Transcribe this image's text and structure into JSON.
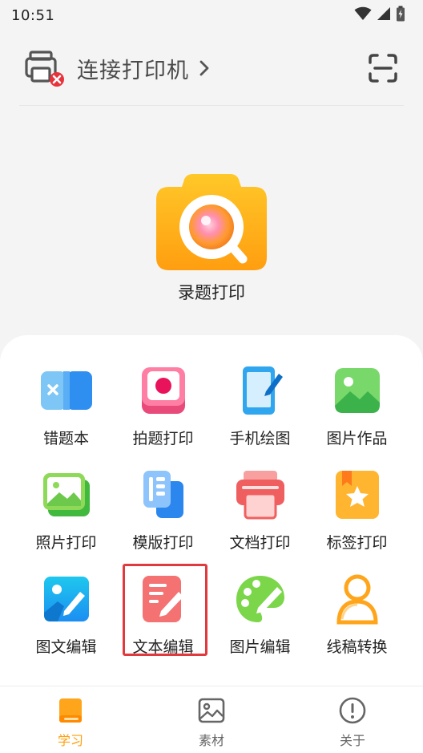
{
  "status_bar": {
    "time": "10:51",
    "icons": [
      "wifi-icon",
      "signal-icon",
      "battery-charging-icon"
    ]
  },
  "header": {
    "printer_label": "连接打印机",
    "icons": [
      "printer-disconnected-icon",
      "chevron-right-icon",
      "scan-icon"
    ]
  },
  "hero": {
    "label": "录题打印",
    "icon": "camera-search-icon",
    "accent": "#ffb31a"
  },
  "grid": {
    "items": [
      {
        "label": "错题本",
        "icon": "wrong-book-icon"
      },
      {
        "label": "拍题打印",
        "icon": "photo-question-print-icon"
      },
      {
        "label": "手机绘图",
        "icon": "phone-drawing-icon"
      },
      {
        "label": "图片作品",
        "icon": "picture-works-icon"
      },
      {
        "label": "照片打印",
        "icon": "photo-print-icon"
      },
      {
        "label": "模版打印",
        "icon": "template-print-icon"
      },
      {
        "label": "文档打印",
        "icon": "document-print-icon"
      },
      {
        "label": "标签打印",
        "icon": "label-print-icon"
      },
      {
        "label": "图文编辑",
        "icon": "image-text-edit-icon"
      },
      {
        "label": "文本编辑",
        "icon": "text-edit-icon",
        "highlighted": true,
        "highlight_color": "#e0393e"
      },
      {
        "label": "图片编辑",
        "icon": "image-edit-palette-icon"
      },
      {
        "label": "线稿转换",
        "icon": "line-art-convert-icon"
      }
    ]
  },
  "bottom_nav": {
    "active_color": "#ff9f0a",
    "items": [
      {
        "label": "学习",
        "icon": "book-icon",
        "active": true
      },
      {
        "label": "素材",
        "icon": "image-gallery-icon",
        "active": false
      },
      {
        "label": "关于",
        "icon": "info-icon",
        "active": false
      }
    ]
  }
}
